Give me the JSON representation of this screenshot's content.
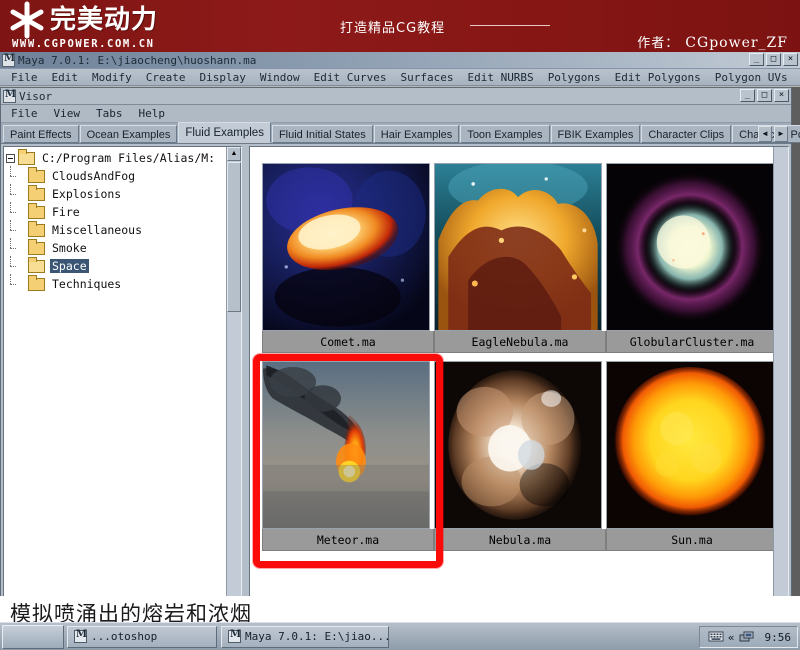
{
  "banner": {
    "logo_text": "完美动力",
    "url": "WWW.CGPOWER.COM.CN",
    "slogan": "打造精品CG教程",
    "author_label": "作者：",
    "author_name": "CGpower_ZF",
    "bg_color": "#851614"
  },
  "maya": {
    "title": "Maya 7.0.1: E:\\jiaocheng\\huoshann.ma",
    "window_buttons": [
      "_",
      "□",
      "×"
    ],
    "menus": [
      "File",
      "Edit",
      "Modify",
      "Create",
      "Display",
      "Window",
      "Edit Curves",
      "Surfaces",
      "Edit NURBS",
      "Polygons",
      "Edit Polygons",
      "Polygon UVs"
    ]
  },
  "visor": {
    "title": "Visor",
    "window_buttons": [
      "_",
      "□",
      "×"
    ],
    "menus": [
      "File",
      "View",
      "Tabs",
      "Help"
    ],
    "tabs": [
      {
        "label": "Paint Effects",
        "active": false
      },
      {
        "label": "Ocean Examples",
        "active": false
      },
      {
        "label": "Fluid Examples",
        "active": true
      },
      {
        "label": "Fluid Initial States",
        "active": false
      },
      {
        "label": "Hair Examples",
        "active": false
      },
      {
        "label": "Toon Examples",
        "active": false
      },
      {
        "label": "FBIK Examples",
        "active": false
      },
      {
        "label": "Character Clips",
        "active": false
      },
      {
        "label": "Character Poses",
        "active": false
      }
    ],
    "tab_scroll_left": "◄",
    "tab_scroll_right": "►",
    "tree": {
      "root": "C:/Program Files/Alias/M:",
      "items": [
        {
          "label": "CloudsAndFog",
          "selected": false
        },
        {
          "label": "Explosions",
          "selected": false
        },
        {
          "label": "Fire",
          "selected": false
        },
        {
          "label": "Miscellaneous",
          "selected": false
        },
        {
          "label": "Smoke",
          "selected": false
        },
        {
          "label": "Space",
          "selected": true
        },
        {
          "label": "Techniques",
          "selected": false
        }
      ]
    },
    "thumbnails": [
      {
        "name": "Comet.ma",
        "kind": "comet"
      },
      {
        "name": "EagleNebula.ma",
        "kind": "eagle"
      },
      {
        "name": "GlobularCluster.ma",
        "kind": "globular"
      },
      {
        "name": "Meteor.ma",
        "kind": "meteor",
        "annotated": true
      },
      {
        "name": "Nebula.ma",
        "kind": "nebula"
      },
      {
        "name": "Sun.ma",
        "kind": "sun"
      }
    ],
    "annotation_color": "#fb0a0a"
  },
  "caption": {
    "text": "模拟喷涌出的熔岩和浓烟"
  },
  "taskbar": {
    "start_label": "",
    "tasks": [
      {
        "label": "...otoshop",
        "icon": "photoshop-icon"
      },
      {
        "label": "Maya 7.0.1: E:\\jiao...",
        "icon": "maya-icon"
      }
    ],
    "tray": {
      "ime_icon": "keyboard-icon",
      "chevron": "«",
      "network_icon": "network-icon",
      "clock": "9:56"
    }
  }
}
